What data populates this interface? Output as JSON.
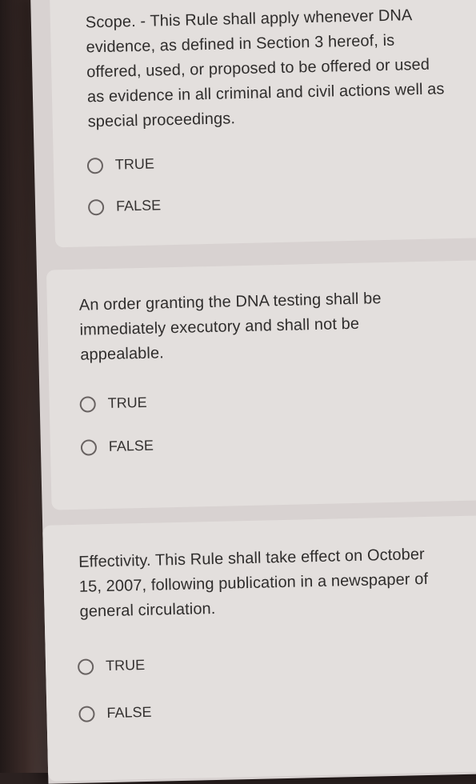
{
  "questions": [
    {
      "text": "Scope. - This Rule shall apply whenever DNA evidence, as defined in Section 3 hereof, is offered, used, or proposed to be offered or used as evidence in all criminal and civil actions well as special proceedings.",
      "options": [
        "TRUE",
        "FALSE"
      ]
    },
    {
      "text": "An order granting the DNA testing shall be immediately executory and shall not be appealable.",
      "options": [
        "TRUE",
        "FALSE"
      ]
    },
    {
      "text": "Effectivity. This Rule shall take effect on October 15, 2007, following publication in a newspaper of general circulation.",
      "options": [
        "TRUE",
        "FALSE"
      ]
    }
  ],
  "colors": {
    "card_background": "#e3dfdd",
    "page_background": "#d8d2d1",
    "radio_outline": "#686261",
    "text": "#2f2d2c"
  },
  "icons": {
    "radio": "radio-button-unchecked-icon"
  }
}
